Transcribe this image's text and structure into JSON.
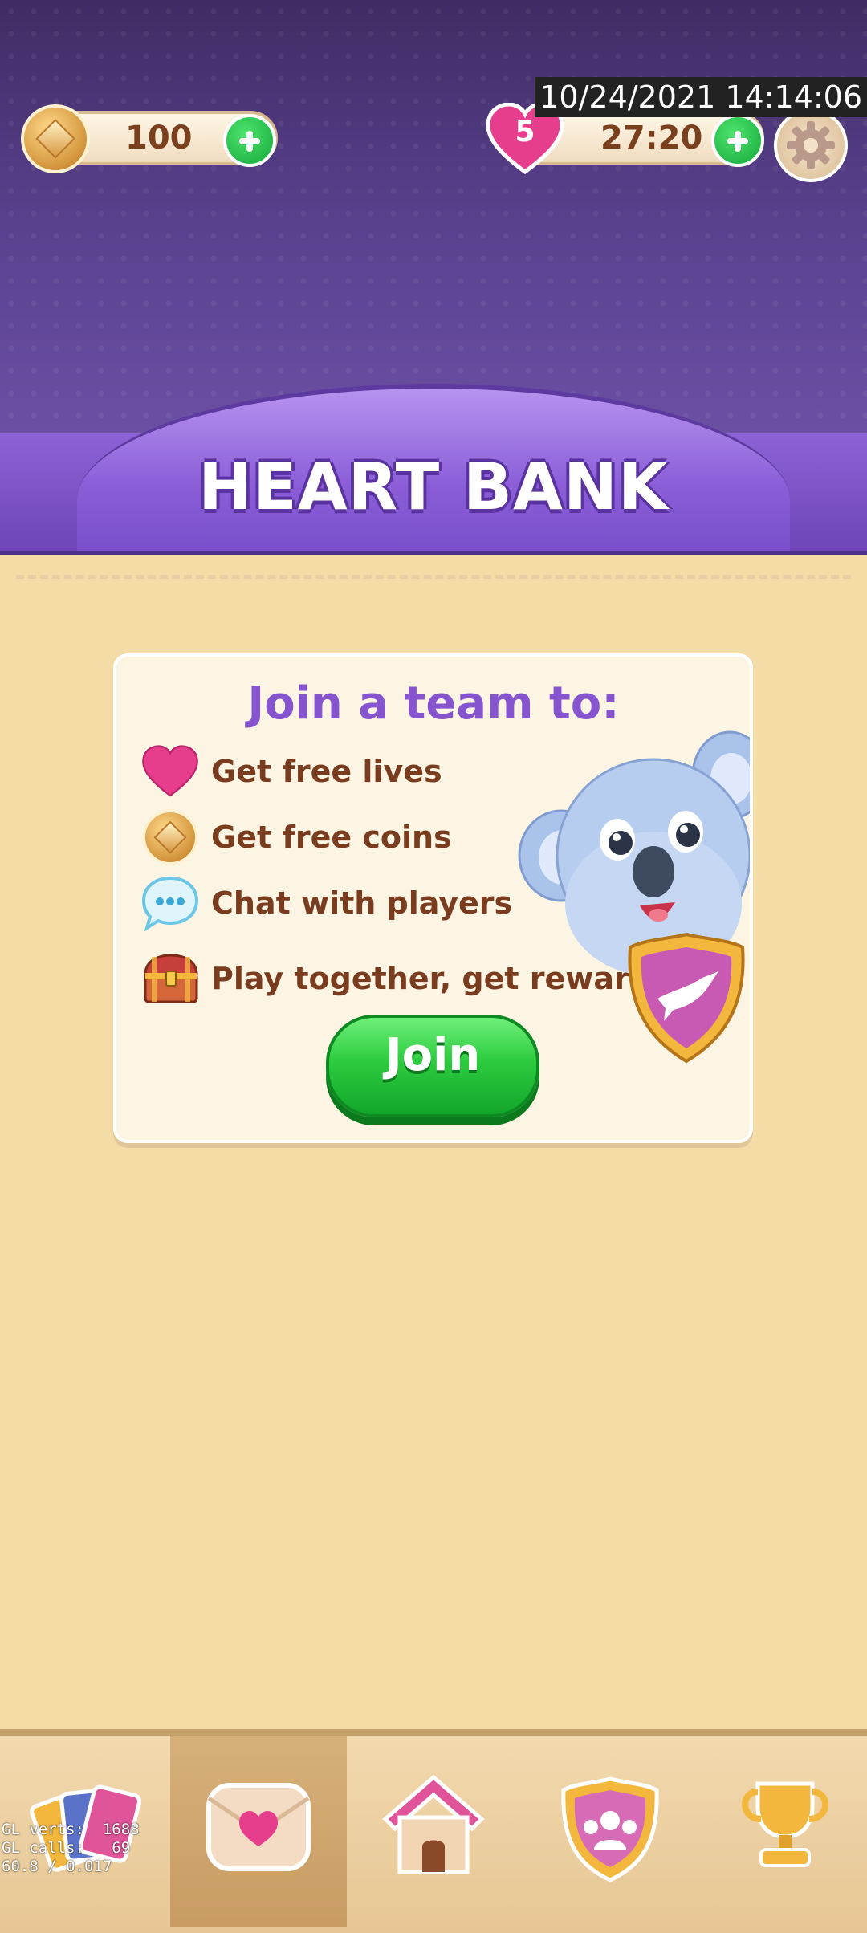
{
  "status": {
    "timestamp": "10/24/2021 14:14:06"
  },
  "hud": {
    "coins": "100",
    "lives": "5",
    "timer": "27:20"
  },
  "banner": {
    "title": "HEART BANK"
  },
  "panel": {
    "title": "Join a team to:",
    "benefits": [
      {
        "icon": "heart-icon",
        "label": "Get free lives"
      },
      {
        "icon": "coin-icon",
        "label": "Get free coins"
      },
      {
        "icon": "chat-bubble-icon",
        "label": "Chat with players"
      },
      {
        "icon": "treasure-chest-icon",
        "label": "Play together, get rewards!"
      }
    ],
    "join_label": "Join"
  },
  "bottom_nav": {
    "items": [
      {
        "name": "cards",
        "icon": "cards-icon",
        "active": false
      },
      {
        "name": "heart-bank",
        "icon": "heart-envelope-icon",
        "active": true
      },
      {
        "name": "home",
        "icon": "house-icon",
        "active": false
      },
      {
        "name": "team",
        "icon": "team-icon",
        "active": false
      },
      {
        "name": "leaderboard",
        "icon": "trophy-icon",
        "active": false
      }
    ]
  },
  "debug": {
    "line1": "GL verts:  1688",
    "line2": "GL calls:   69",
    "line3": "60.8 / 0.017"
  },
  "colors": {
    "purple_banner": "#8d62d6",
    "title_purple": "#8654cf",
    "text_brown": "#7a3c1e",
    "join_green": "#2dcb3f",
    "heart_pink": "#e63d8c"
  }
}
